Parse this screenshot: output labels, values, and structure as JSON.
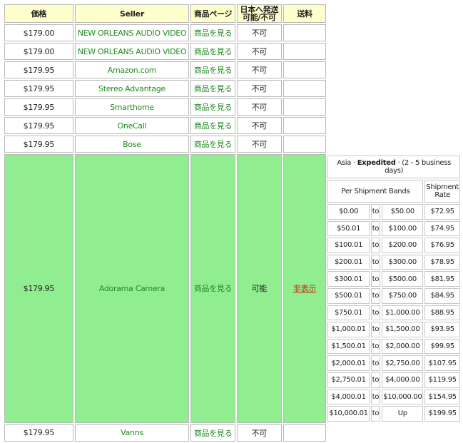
{
  "headers": {
    "price": "価格",
    "seller": "Seller",
    "product_page": "商品ページ",
    "ship_to_japan_line1": "日本へ発送",
    "ship_to_japan_line2": "可能/不可",
    "shipping_fee": "送料"
  },
  "rows": [
    {
      "price": "$179.00",
      "seller": "NEW ORLEANS AUDIO VIDEO",
      "page_link": "商品を見る",
      "ship": "不可",
      "fee": ""
    },
    {
      "price": "$179.00",
      "seller": "NEW ORLEANS AUDIO VIDEO",
      "page_link": "商品を見る",
      "ship": "不可",
      "fee": ""
    },
    {
      "price": "$179.95",
      "seller": "Amazon.com",
      "page_link": "商品を見る",
      "ship": "不可",
      "fee": ""
    },
    {
      "price": "$179.95",
      "seller": "Stereo Advantage",
      "page_link": "商品を見る",
      "ship": "不可",
      "fee": ""
    },
    {
      "price": "$179.95",
      "seller": "Smarthome",
      "page_link": "商品を見る",
      "ship": "不可",
      "fee": ""
    },
    {
      "price": "$179.95",
      "seller": "OneCall",
      "page_link": "商品を見る",
      "ship": "不可",
      "fee": ""
    },
    {
      "price": "$179.95",
      "seller": "Bose",
      "page_link": "商品を見る",
      "ship": "不可",
      "fee": ""
    }
  ],
  "highlight_row": {
    "price": "$179.95",
    "seller": "Adorama Camera",
    "page_link": "商品を見る",
    "ship": "可能",
    "fee_link": "非表示",
    "color": "#90ee90"
  },
  "last_row": {
    "price": "$179.95",
    "seller": "Vanns",
    "page_link": "商品を見る",
    "ship": "不可",
    "fee": ""
  },
  "rates": {
    "title_region": "Asia",
    "title_sep": " · ",
    "title_method": "Expedited",
    "title_rest": " · (2 - 5 business days)",
    "band_header": "Per Shipment Bands",
    "rate_header_line1": "Shipment",
    "rate_header_line2": "Rate",
    "bands": [
      {
        "from": "$0.00",
        "to": "to",
        "upto": "$50.00",
        "rate": "$72.95"
      },
      {
        "from": "$50.01",
        "to": "to",
        "upto": "$100.00",
        "rate": "$74.95"
      },
      {
        "from": "$100.01",
        "to": "to",
        "upto": "$200.00",
        "rate": "$76.95"
      },
      {
        "from": "$200.01",
        "to": "to",
        "upto": "$300.00",
        "rate": "$78.95"
      },
      {
        "from": "$300.01",
        "to": "to",
        "upto": "$500.00",
        "rate": "$81.95"
      },
      {
        "from": "$500.01",
        "to": "to",
        "upto": "$750.00",
        "rate": "$84.95"
      },
      {
        "from": "$750.01",
        "to": "to",
        "upto": "$1,000.00",
        "rate": "$88.95"
      },
      {
        "from": "$1,000.01",
        "to": "to",
        "upto": "$1,500.00",
        "rate": "$93.95"
      },
      {
        "from": "$1,500.01",
        "to": "to",
        "upto": "$2,000.00",
        "rate": "$99.95"
      },
      {
        "from": "$2,000.01",
        "to": "to",
        "upto": "$2,750.00",
        "rate": "$107.95"
      },
      {
        "from": "$2,750.01",
        "to": "to",
        "upto": "$4,000.00",
        "rate": "$119.95"
      },
      {
        "from": "$4,000.01",
        "to": "to",
        "upto": "$10,000.00",
        "rate": "$154.95"
      },
      {
        "from": "$10,000.01",
        "to": "to",
        "upto": "Up",
        "rate": "$199.95"
      }
    ]
  },
  "colors": {
    "header_bg": "#ffffcc",
    "link_green": "#228b22",
    "hidden_link_red": "#cc2200"
  }
}
